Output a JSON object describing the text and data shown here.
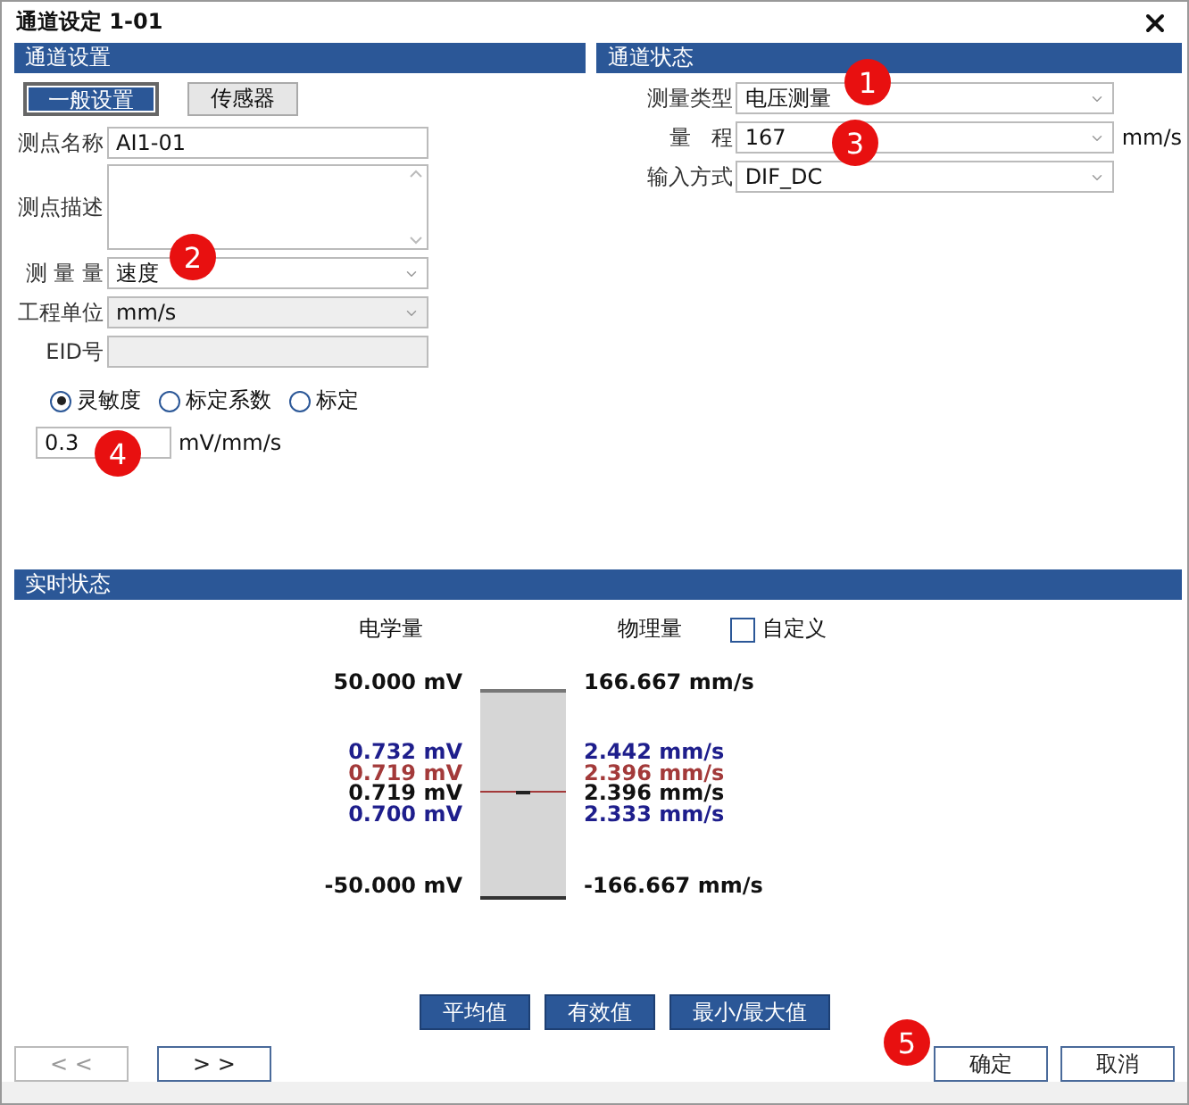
{
  "window": {
    "title": "通道设定 1-01"
  },
  "channel_settings": {
    "header": "通道设置",
    "tabs": [
      {
        "label": "一般设置",
        "selected": true
      },
      {
        "label": "传感器",
        "selected": false
      }
    ],
    "fields": [
      {
        "kind": "text",
        "label": "测点名称",
        "value": "AI1-01",
        "disabled": false
      },
      {
        "kind": "textarea",
        "label": "测点描述",
        "disabled": false
      },
      {
        "kind": "select",
        "label": "测 量 量",
        "value": "速度",
        "disabled": false
      },
      {
        "kind": "select",
        "label": "工程单位",
        "value": "mm/s",
        "disabled": true
      },
      {
        "kind": "text",
        "label": "EID号",
        "disabled": true
      }
    ],
    "modes": [
      {
        "label": "灵敏度",
        "selected": true
      },
      {
        "label": "标定系数",
        "selected": false
      },
      {
        "label": "标定",
        "selected": false
      }
    ],
    "sensitivity": {
      "value": "0.3",
      "unit": "mV/mm/s"
    }
  },
  "channel_status": {
    "header": "通道状态",
    "fields": [
      {
        "label": "测量类型",
        "value": "电压测量"
      },
      {
        "label": "量   程",
        "value": "167",
        "unit": "mm/s"
      },
      {
        "label": "输入方式",
        "value": "DIF_DC"
      }
    ]
  },
  "realtime": {
    "header": "实时状态",
    "electrical_heading": "电学量",
    "physical_heading": "物理量",
    "custom": {
      "label": "自定义",
      "checked": false
    },
    "top": {
      "electrical": "50.000 mV",
      "physical": "166.667 mm/s"
    },
    "readings": [
      {
        "electrical": "0.732 mV",
        "physical": "2.442 mm/s",
        "color": "#1e1e8c"
      },
      {
        "electrical": "0.719 mV",
        "physical": "2.396 mm/s",
        "color": "#a33a3a"
      },
      {
        "electrical": "0.719 mV",
        "physical": "2.396 mm/s",
        "color": "#111111"
      },
      {
        "electrical": "0.700 mV",
        "physical": "2.333 mm/s",
        "color": "#1e1e8c"
      }
    ],
    "bottom": {
      "electrical": "-50.000 mV",
      "physical": "-166.667 mm/s"
    },
    "level": 0.507,
    "buttons": [
      "平均值",
      "有效值",
      "最小/最大值"
    ]
  },
  "nav_buttons": [
    {
      "label": "< <",
      "disabled": true
    },
    {
      "label": "> >",
      "disabled": false
    }
  ],
  "dialog_buttons": [
    "确定",
    "取消"
  ],
  "callouts": [
    "1",
    "2",
    "3",
    "4",
    "5"
  ]
}
